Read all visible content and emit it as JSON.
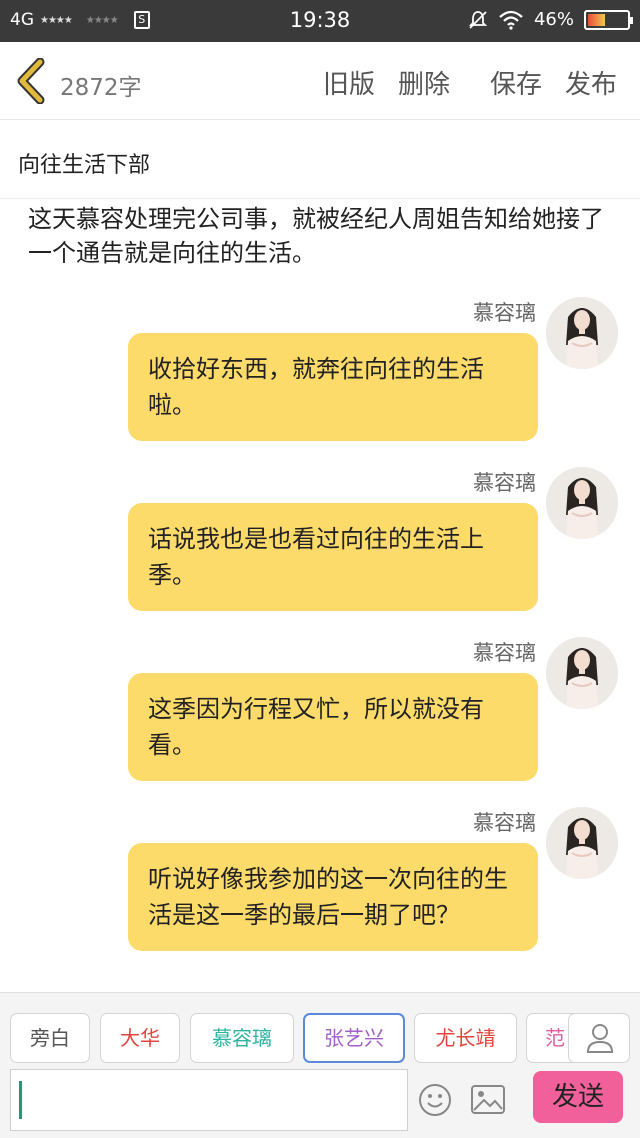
{
  "status_bar": {
    "network": "4G",
    "time": "19:38",
    "battery": "46%",
    "battery_level": 0.46
  },
  "header": {
    "word_count": "2872字",
    "actions": {
      "old_version": "旧版",
      "delete": "删除",
      "save": "保存",
      "publish": "发布"
    }
  },
  "title": "向往生活下部",
  "narration": "这天慕容处理完公司事，就被经纪人周姐告知给她接了一个通告就是向往的生活。",
  "messages": [
    {
      "speaker": "慕容璃",
      "text": "收拾好东西，就奔往向往的生活啦。"
    },
    {
      "speaker": "慕容璃",
      "text": "话说我也是也看过向往的生活上季。"
    },
    {
      "speaker": "慕容璃",
      "text": "这季因为行程又忙，所以就没有看。"
    },
    {
      "speaker": "慕容璃",
      "text": "听说好像我参加的这一次向往的生活是这一季的最后一期了吧？"
    }
  ],
  "roles": [
    {
      "label": "旁白",
      "color": "#555555"
    },
    {
      "label": "大华",
      "color": "#e0443e"
    },
    {
      "label": "慕容璃",
      "color": "#2bb5a0"
    },
    {
      "label": "张艺兴",
      "color": "#a35fc8",
      "selected": true
    },
    {
      "label": "尤长靖",
      "color": "#e0443e"
    },
    {
      "label": "范",
      "color": "#e25aa0"
    }
  ],
  "composer": {
    "input_value": "",
    "send_label": "发送"
  },
  "colors": {
    "bubble": "#fcdb6b",
    "send_button": "#f1609b",
    "accent_back": "#e1b93d"
  }
}
